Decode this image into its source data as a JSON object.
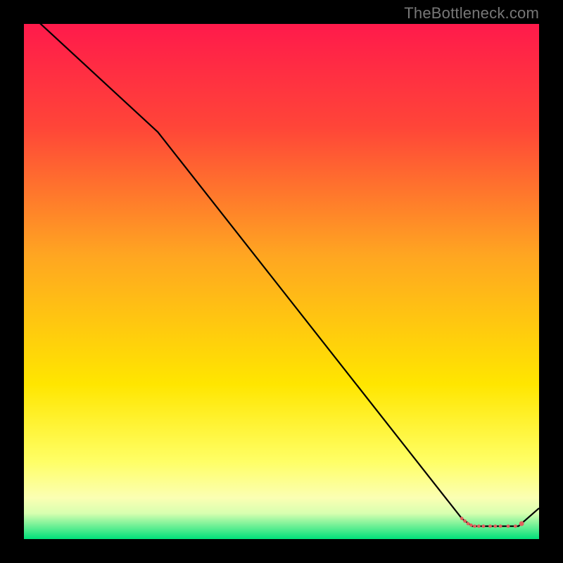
{
  "watermark": "TheBottleneck.com",
  "chart_data": {
    "type": "line",
    "title": "",
    "xlabel": "",
    "ylabel": "",
    "xlim": [
      0,
      100
    ],
    "ylim": [
      0,
      100
    ],
    "gradient_stops": [
      {
        "offset": 0,
        "color": "#ff1a4b"
      },
      {
        "offset": 20,
        "color": "#ff4538"
      },
      {
        "offset": 45,
        "color": "#ffa621"
      },
      {
        "offset": 70,
        "color": "#ffe600"
      },
      {
        "offset": 85,
        "color": "#ffff66"
      },
      {
        "offset": 92,
        "color": "#fbffb3"
      },
      {
        "offset": 95,
        "color": "#d8ffb0"
      },
      {
        "offset": 100,
        "color": "#00e07a"
      }
    ],
    "series": [
      {
        "name": "main-curve",
        "stroke": "#000000",
        "stroke_width": 2.2,
        "points": [
          {
            "x": 0,
            "y": 103
          },
          {
            "x": 26,
            "y": 79
          },
          {
            "x": 85,
            "y": 4
          },
          {
            "x": 87,
            "y": 2.5
          },
          {
            "x": 96,
            "y": 2.5
          },
          {
            "x": 100,
            "y": 6
          }
        ]
      },
      {
        "name": "valley-markers",
        "stroke": "#e0615e",
        "marker_radius_small": 2.4,
        "marker_radius_large": 3.4,
        "points": [
          {
            "x": 85.0,
            "y": 4.0,
            "r": "small"
          },
          {
            "x": 85.6,
            "y": 3.5,
            "r": "small"
          },
          {
            "x": 86.2,
            "y": 3.0,
            "r": "small"
          },
          {
            "x": 86.8,
            "y": 2.7,
            "r": "small"
          },
          {
            "x": 87.5,
            "y": 2.5,
            "r": "small"
          },
          {
            "x": 88.3,
            "y": 2.5,
            "r": "small"
          },
          {
            "x": 89.2,
            "y": 2.5,
            "r": "small"
          },
          {
            "x": 90.5,
            "y": 2.5,
            "r": "small"
          },
          {
            "x": 91.5,
            "y": 2.5,
            "r": "small"
          },
          {
            "x": 92.5,
            "y": 2.5,
            "r": "small"
          },
          {
            "x": 94.0,
            "y": 2.5,
            "r": "small"
          },
          {
            "x": 95.4,
            "y": 2.5,
            "r": "small"
          },
          {
            "x": 96.6,
            "y": 3.0,
            "r": "large"
          }
        ]
      }
    ]
  }
}
